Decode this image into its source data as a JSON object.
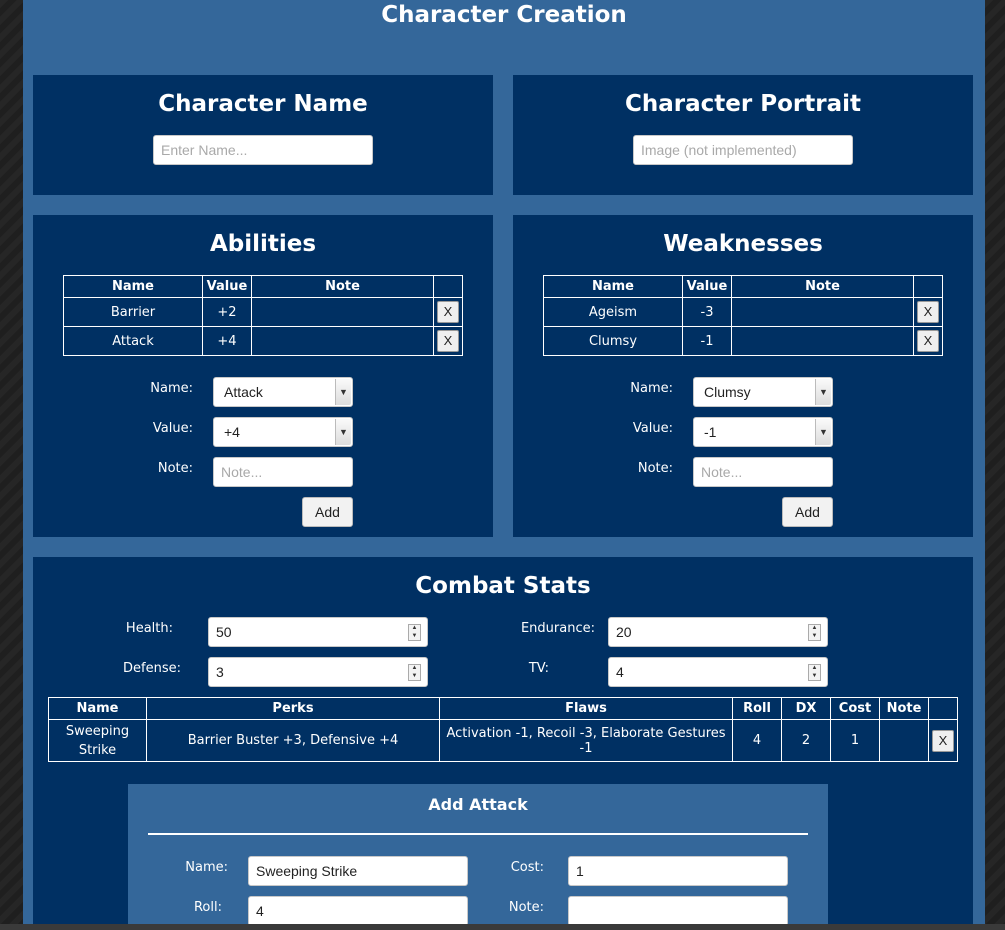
{
  "page": {
    "title": "Character Creation"
  },
  "name_panel": {
    "title": "Character Name",
    "input_placeholder": "Enter Name..."
  },
  "portrait_panel": {
    "title": "Character Portrait",
    "input_placeholder": "Image (not implemented)"
  },
  "abilities": {
    "title": "Abilities",
    "columns": [
      "Name",
      "Value",
      "Note",
      ""
    ],
    "rows": [
      {
        "name": "Barrier",
        "value": "+2",
        "note": ""
      },
      {
        "name": "Attack",
        "value": "+4",
        "note": ""
      }
    ],
    "remove_label": "X",
    "form": {
      "name_label": "Name:",
      "name_value": "Attack",
      "value_label": "Value:",
      "value_value": "+4",
      "note_label": "Note:",
      "note_placeholder": "Note...",
      "add_label": "Add"
    }
  },
  "weaknesses": {
    "title": "Weaknesses",
    "columns": [
      "Name",
      "Value",
      "Note",
      ""
    ],
    "rows": [
      {
        "name": "Ageism",
        "value": "-3",
        "note": ""
      },
      {
        "name": "Clumsy",
        "value": "-1",
        "note": ""
      }
    ],
    "remove_label": "X",
    "form": {
      "name_label": "Name:",
      "name_value": "Clumsy",
      "value_label": "Value:",
      "value_value": "-1",
      "note_label": "Note:",
      "note_placeholder": "Note...",
      "add_label": "Add"
    }
  },
  "combat": {
    "title": "Combat Stats",
    "health_label": "Health:",
    "health_value": "50",
    "endurance_label": "Endurance:",
    "endurance_value": "20",
    "defense_label": "Defense:",
    "defense_value": "3",
    "tv_label": "TV:",
    "tv_value": "4",
    "attack_table": {
      "columns": [
        "Name",
        "Perks",
        "Flaws",
        "Roll",
        "DX",
        "Cost",
        "Note",
        ""
      ],
      "rows": [
        {
          "name": "Sweeping Strike",
          "perks": "Barrier Buster +3, Defensive +4",
          "flaws": "Activation -1, Recoil -3, Elaborate Gestures -1",
          "roll": "4",
          "dx": "2",
          "cost": "1",
          "note": ""
        }
      ],
      "remove_label": "X"
    },
    "add_attack": {
      "title": "Add Attack",
      "name_label": "Name:",
      "name_value": "Sweeping Strike",
      "cost_label": "Cost:",
      "cost_value": "1",
      "roll_label": "Roll:",
      "roll_value": "4",
      "note_label": "Note:",
      "note_value": ""
    }
  }
}
